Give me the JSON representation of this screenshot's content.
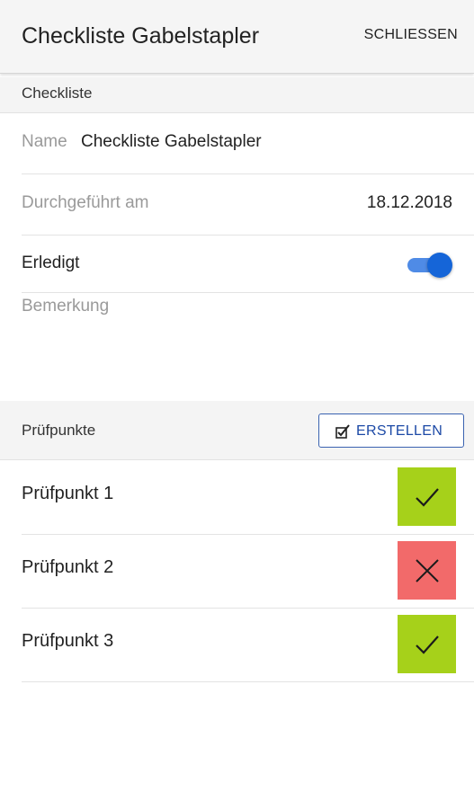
{
  "appbar": {
    "title": "Checkliste Gabelstapler",
    "close_label": "SCHLIESSEN"
  },
  "checklist_section": {
    "header": "Checkliste"
  },
  "fields": {
    "name_label": "Name",
    "name_value": "Checkliste Gabelstapler",
    "date_label": "Durchgeführt am",
    "date_value": "18.12.2018",
    "done_label": "Erledigt",
    "done_value": true,
    "remark_placeholder": "Bemerkung"
  },
  "checkpoints_section": {
    "header": "Prüfpunkte",
    "create_label": "ERSTELLEN"
  },
  "checkpoints": [
    {
      "label": "Prüfpunkt 1",
      "status": "ok",
      "icon": "check-icon"
    },
    {
      "label": "Prüfpunkt 2",
      "status": "failed",
      "icon": "close-icon"
    },
    {
      "label": "Prüfpunkt 3",
      "status": "ok",
      "icon": "check-icon"
    }
  ],
  "colors": {
    "ok": "#a6d11a",
    "failed": "#f26a6a",
    "accent": "#1565d8"
  }
}
